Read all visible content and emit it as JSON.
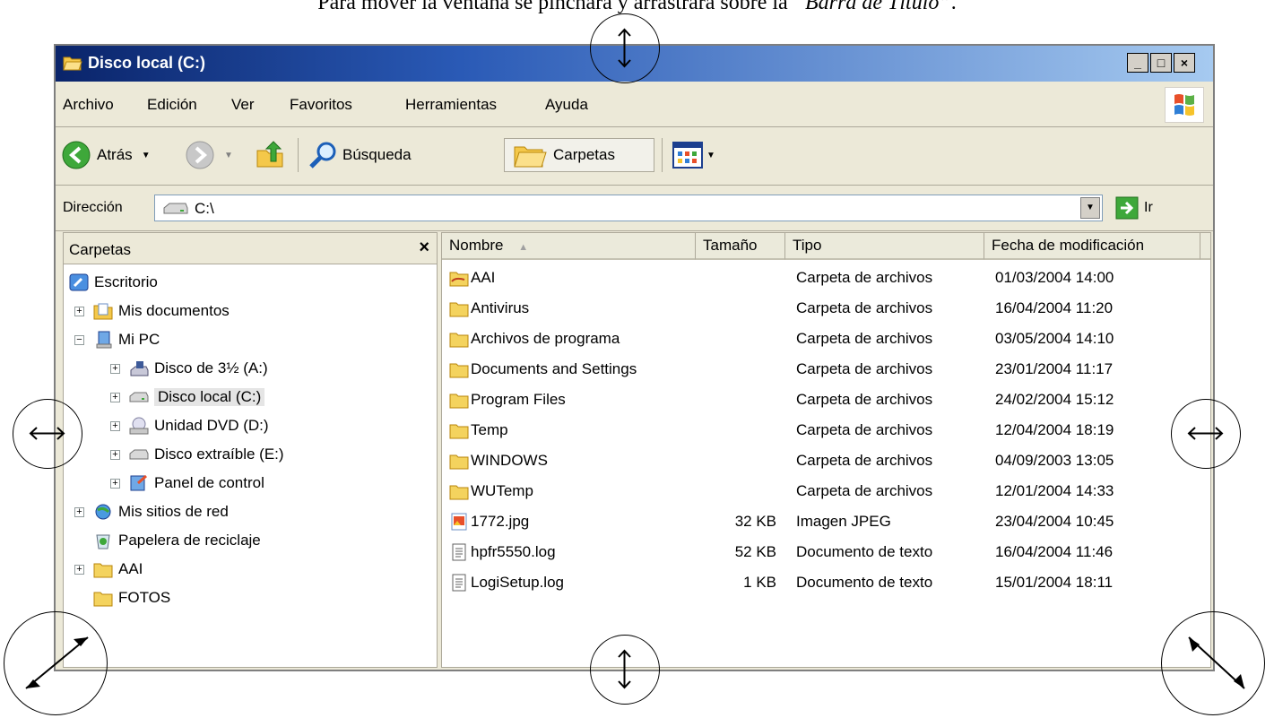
{
  "caption": {
    "prefix": "Para mover la ventana se pinchará y arrastrará sobre la ",
    "italic": "“Barra de Título”",
    "suffix": "."
  },
  "window": {
    "title": "Disco local (C:)",
    "controls": {
      "minimize": "_",
      "maximize": "□",
      "close": "×"
    },
    "menu": [
      "Archivo",
      "Edición",
      "Ver",
      "Favoritos",
      "Herramientas",
      "Ayuda"
    ],
    "toolbar": {
      "back": "Atrás",
      "search": "Búsqueda",
      "folders": "Carpetas"
    },
    "address": {
      "label": "Dirección",
      "value": "C:\\",
      "go": "Ir"
    },
    "folders_pane": {
      "title": "Carpetas",
      "close": "×",
      "items": [
        {
          "label": "Escritorio"
        },
        {
          "label": "Mis documentos",
          "expander": "+"
        },
        {
          "label": "Mi PC",
          "expander": "−"
        },
        {
          "label": "Disco de 3½ (A:)",
          "expander": "+"
        },
        {
          "label": "Disco local (C:)",
          "expander": "+",
          "selected": true
        },
        {
          "label": "Unidad DVD (D:)",
          "expander": "+"
        },
        {
          "label": "Disco extraíble (E:)",
          "expander": "+"
        },
        {
          "label": "Panel de control",
          "expander": "+"
        },
        {
          "label": "Mis sitios de red",
          "expander": "+"
        },
        {
          "label": "Papelera de reciclaje"
        },
        {
          "label": "AAI",
          "expander": "+"
        },
        {
          "label": "FOTOS"
        }
      ]
    },
    "files": {
      "columns": [
        "Nombre",
        "Tamaño",
        "Tipo",
        "Fecha de modificación"
      ],
      "sort_arrow": "▲",
      "rows": [
        {
          "name": "AAI",
          "size": "",
          "type": "Carpeta de archivos",
          "date": "01/03/2004 14:00",
          "icon": "shared-folder-icon"
        },
        {
          "name": "Antivirus",
          "size": "",
          "type": "Carpeta de archivos",
          "date": "16/04/2004 11:20",
          "icon": "folder-icon"
        },
        {
          "name": "Archivos de programa",
          "size": "",
          "type": "Carpeta de archivos",
          "date": "03/05/2004 14:10",
          "icon": "folder-icon"
        },
        {
          "name": "Documents and Settings",
          "size": "",
          "type": "Carpeta de archivos",
          "date": "23/01/2004 11:17",
          "icon": "folder-icon"
        },
        {
          "name": "Program Files",
          "size": "",
          "type": "Carpeta de archivos",
          "date": "24/02/2004 15:12",
          "icon": "folder-icon"
        },
        {
          "name": "Temp",
          "size": "",
          "type": "Carpeta de archivos",
          "date": "12/04/2004 18:19",
          "icon": "folder-icon"
        },
        {
          "name": "WINDOWS",
          "size": "",
          "type": "Carpeta de archivos",
          "date": "04/09/2003 13:05",
          "icon": "folder-icon"
        },
        {
          "name": "WUTemp",
          "size": "",
          "type": "Carpeta de archivos",
          "date": "12/01/2004 14:33",
          "icon": "folder-icon"
        },
        {
          "name": "1772.jpg",
          "size": "32 KB",
          "type": "Imagen JPEG",
          "date": "23/04/2004 10:45",
          "icon": "image-file-icon"
        },
        {
          "name": "hpfr5550.log",
          "size": "52 KB",
          "type": "Documento de texto",
          "date": "16/04/2004 11:46",
          "icon": "text-file-icon"
        },
        {
          "name": "LogiSetup.log",
          "size": "1 KB",
          "type": "Documento de texto",
          "date": "15/01/2004 18:11",
          "icon": "text-file-icon"
        }
      ]
    }
  },
  "annotations": {
    "top": "↕",
    "left": "↔",
    "right": "↔",
    "bottom": "↕",
    "bottom_left": "resize-diagonal-sw-ne-icon",
    "bottom_right": "resize-diagonal-nw-se-icon"
  },
  "colors": {
    "titlebar_start": "#0a246a",
    "titlebar_end": "#a6caf0",
    "window_bg": "#ece9d8",
    "folder": "#f4d35e"
  }
}
